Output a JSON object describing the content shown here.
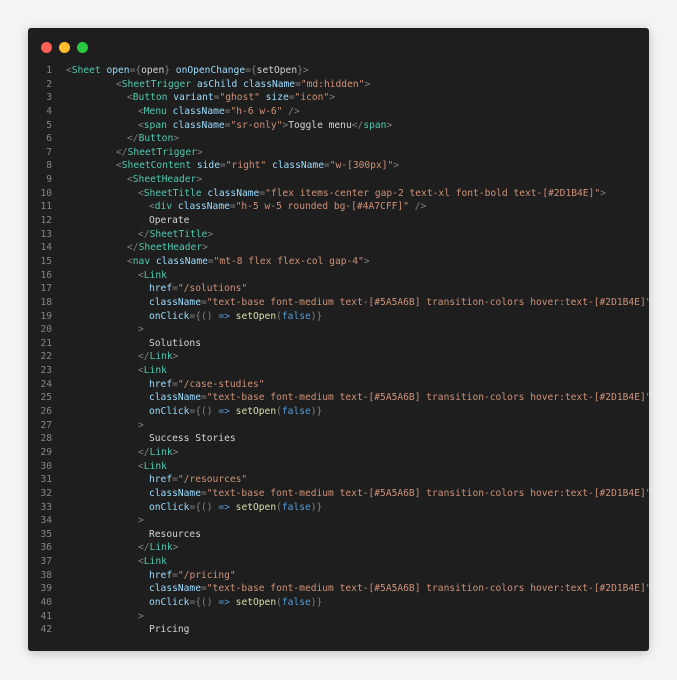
{
  "window": {
    "controls": [
      {
        "name": "close",
        "color": "#ff5f57"
      },
      {
        "name": "minimize",
        "color": "#febc2e"
      },
      {
        "name": "maximize",
        "color": "#28c840"
      }
    ]
  },
  "colors": {
    "background": "#1e1e1e",
    "line_number": "#858585",
    "tag": "#4ec9b0",
    "attr": "#9cdcfe",
    "string": "#ce9178",
    "text": "#d4d4d4",
    "keyword": "#569cd6"
  },
  "code_lines": [
    {
      "n": "1",
      "indent": 0,
      "tokens": [
        [
          "p",
          "<"
        ],
        [
          "t",
          "Sheet"
        ],
        [
          "x",
          " "
        ],
        [
          "a",
          "open"
        ],
        [
          "p",
          "={"
        ],
        [
          "x",
          "open"
        ],
        [
          "p",
          "} "
        ],
        [
          "a",
          "onOpenChange"
        ],
        [
          "p",
          "={"
        ],
        [
          "x",
          "setOpen"
        ],
        [
          "p",
          "}>"
        ]
      ]
    },
    {
      "n": "2",
      "indent": 1,
      "tokens": [
        [
          "p",
          "<"
        ],
        [
          "t",
          "SheetTrigger"
        ],
        [
          "x",
          " "
        ],
        [
          "a",
          "asChild"
        ],
        [
          "x",
          " "
        ],
        [
          "a",
          "className"
        ],
        [
          "p",
          "="
        ],
        [
          "s",
          "\"md:hidden\""
        ],
        [
          "p",
          ">"
        ]
      ]
    },
    {
      "n": "3",
      "indent": 2,
      "tokens": [
        [
          "p",
          "<"
        ],
        [
          "t",
          "Button"
        ],
        [
          "x",
          " "
        ],
        [
          "a",
          "variant"
        ],
        [
          "p",
          "="
        ],
        [
          "s",
          "\"ghost\""
        ],
        [
          "x",
          " "
        ],
        [
          "a",
          "size"
        ],
        [
          "p",
          "="
        ],
        [
          "s",
          "\"icon\""
        ],
        [
          "p",
          ">"
        ]
      ]
    },
    {
      "n": "4",
      "indent": 3,
      "tokens": [
        [
          "p",
          "<"
        ],
        [
          "t",
          "Menu"
        ],
        [
          "x",
          " "
        ],
        [
          "a",
          "className"
        ],
        [
          "p",
          "="
        ],
        [
          "s",
          "\"h-6 w-6\""
        ],
        [
          "x",
          " "
        ],
        [
          "p",
          "/>"
        ]
      ]
    },
    {
      "n": "5",
      "indent": 3,
      "tokens": [
        [
          "p",
          "<"
        ],
        [
          "t",
          "span"
        ],
        [
          "x",
          " "
        ],
        [
          "a",
          "className"
        ],
        [
          "p",
          "="
        ],
        [
          "s",
          "\"sr-only\""
        ],
        [
          "p",
          ">"
        ],
        [
          "x",
          "Toggle menu"
        ],
        [
          "p",
          "</"
        ],
        [
          "t",
          "span"
        ],
        [
          "p",
          ">"
        ]
      ]
    },
    {
      "n": "6",
      "indent": 2,
      "tokens": [
        [
          "p",
          "</"
        ],
        [
          "t",
          "Button"
        ],
        [
          "p",
          ">"
        ]
      ]
    },
    {
      "n": "7",
      "indent": 1,
      "tokens": [
        [
          "p",
          "</"
        ],
        [
          "t",
          "SheetTrigger"
        ],
        [
          "p",
          ">"
        ]
      ]
    },
    {
      "n": "8",
      "indent": 1,
      "tokens": [
        [
          "p",
          "<"
        ],
        [
          "t",
          "SheetContent"
        ],
        [
          "x",
          " "
        ],
        [
          "a",
          "side"
        ],
        [
          "p",
          "="
        ],
        [
          "s",
          "\"right\""
        ],
        [
          "x",
          " "
        ],
        [
          "a",
          "className"
        ],
        [
          "p",
          "="
        ],
        [
          "s",
          "\"w-[300px]\""
        ],
        [
          "p",
          ">"
        ]
      ]
    },
    {
      "n": "9",
      "indent": 2,
      "tokens": [
        [
          "p",
          "<"
        ],
        [
          "t",
          "SheetHeader"
        ],
        [
          "p",
          ">"
        ]
      ]
    },
    {
      "n": "10",
      "indent": 3,
      "tokens": [
        [
          "p",
          "<"
        ],
        [
          "t",
          "SheetTitle"
        ],
        [
          "x",
          " "
        ],
        [
          "a",
          "className"
        ],
        [
          "p",
          "="
        ],
        [
          "s",
          "\"flex items-center gap-2 text-xl font-bold text-[#2D1B4E]\""
        ],
        [
          "p",
          ">"
        ]
      ]
    },
    {
      "n": "11",
      "indent": 4,
      "tokens": [
        [
          "p",
          "<"
        ],
        [
          "t",
          "div"
        ],
        [
          "x",
          " "
        ],
        [
          "a",
          "className"
        ],
        [
          "p",
          "="
        ],
        [
          "s",
          "\"h-5 w-5 rounded bg-[#4A7CFF]\""
        ],
        [
          "x",
          " "
        ],
        [
          "p",
          "/>"
        ]
      ]
    },
    {
      "n": "12",
      "indent": 4,
      "tokens": [
        [
          "x",
          "Operate"
        ]
      ]
    },
    {
      "n": "13",
      "indent": 3,
      "tokens": [
        [
          "p",
          "</"
        ],
        [
          "t",
          "SheetTitle"
        ],
        [
          "p",
          ">"
        ]
      ]
    },
    {
      "n": "14",
      "indent": 2,
      "tokens": [
        [
          "p",
          "</"
        ],
        [
          "t",
          "SheetHeader"
        ],
        [
          "p",
          ">"
        ]
      ]
    },
    {
      "n": "15",
      "indent": 2,
      "tokens": [
        [
          "p",
          "<"
        ],
        [
          "t",
          "nav"
        ],
        [
          "x",
          " "
        ],
        [
          "a",
          "className"
        ],
        [
          "p",
          "="
        ],
        [
          "s",
          "\"mt-8 flex flex-col gap-4\""
        ],
        [
          "p",
          ">"
        ]
      ]
    },
    {
      "n": "16",
      "indent": 3,
      "tokens": [
        [
          "p",
          "<"
        ],
        [
          "t",
          "Link"
        ]
      ]
    },
    {
      "n": "17",
      "indent": 4,
      "tokens": [
        [
          "a",
          "href"
        ],
        [
          "p",
          "="
        ],
        [
          "s",
          "\"/solutions\""
        ]
      ]
    },
    {
      "n": "18",
      "indent": 4,
      "tokens": [
        [
          "a",
          "className"
        ],
        [
          "p",
          "="
        ],
        [
          "s",
          "\"text-base font-medium text-[#5A5A6B] transition-colors hover:text-[#2D1B4E]\""
        ]
      ]
    },
    {
      "n": "19",
      "indent": 4,
      "tokens": [
        [
          "a",
          "onClick"
        ],
        [
          "p",
          "={"
        ],
        [
          "p",
          "() "
        ],
        [
          "k",
          "=>"
        ],
        [
          "x",
          " "
        ],
        [
          "f",
          "setOpen"
        ],
        [
          "p",
          "("
        ],
        [
          "k",
          "false"
        ],
        [
          "p",
          ")}"
        ]
      ]
    },
    {
      "n": "20",
      "indent": 3,
      "tokens": [
        [
          "p",
          ">"
        ]
      ]
    },
    {
      "n": "21",
      "indent": 4,
      "tokens": [
        [
          "x",
          "Solutions"
        ]
      ]
    },
    {
      "n": "22",
      "indent": 3,
      "tokens": [
        [
          "p",
          "</"
        ],
        [
          "t",
          "Link"
        ],
        [
          "p",
          ">"
        ]
      ]
    },
    {
      "n": "23",
      "indent": 3,
      "tokens": [
        [
          "p",
          "<"
        ],
        [
          "t",
          "Link"
        ]
      ]
    },
    {
      "n": "24",
      "indent": 4,
      "tokens": [
        [
          "a",
          "href"
        ],
        [
          "p",
          "="
        ],
        [
          "s",
          "\"/case-studies\""
        ]
      ]
    },
    {
      "n": "25",
      "indent": 4,
      "tokens": [
        [
          "a",
          "className"
        ],
        [
          "p",
          "="
        ],
        [
          "s",
          "\"text-base font-medium text-[#5A5A6B] transition-colors hover:text-[#2D1B4E]\""
        ]
      ]
    },
    {
      "n": "26",
      "indent": 4,
      "tokens": [
        [
          "a",
          "onClick"
        ],
        [
          "p",
          "={"
        ],
        [
          "p",
          "() "
        ],
        [
          "k",
          "=>"
        ],
        [
          "x",
          " "
        ],
        [
          "f",
          "setOpen"
        ],
        [
          "p",
          "("
        ],
        [
          "k",
          "false"
        ],
        [
          "p",
          ")}"
        ]
      ]
    },
    {
      "n": "27",
      "indent": 3,
      "tokens": [
        [
          "p",
          ">"
        ]
      ]
    },
    {
      "n": "28",
      "indent": 4,
      "tokens": [
        [
          "x",
          "Success Stories"
        ]
      ]
    },
    {
      "n": "29",
      "indent": 3,
      "tokens": [
        [
          "p",
          "</"
        ],
        [
          "t",
          "Link"
        ],
        [
          "p",
          ">"
        ]
      ]
    },
    {
      "n": "30",
      "indent": 3,
      "tokens": [
        [
          "p",
          "<"
        ],
        [
          "t",
          "Link"
        ]
      ]
    },
    {
      "n": "31",
      "indent": 4,
      "tokens": [
        [
          "a",
          "href"
        ],
        [
          "p",
          "="
        ],
        [
          "s",
          "\"/resources\""
        ]
      ]
    },
    {
      "n": "32",
      "indent": 4,
      "tokens": [
        [
          "a",
          "className"
        ],
        [
          "p",
          "="
        ],
        [
          "s",
          "\"text-base font-medium text-[#5A5A6B] transition-colors hover:text-[#2D1B4E]\""
        ]
      ]
    },
    {
      "n": "33",
      "indent": 4,
      "tokens": [
        [
          "a",
          "onClick"
        ],
        [
          "p",
          "={"
        ],
        [
          "p",
          "() "
        ],
        [
          "k",
          "=>"
        ],
        [
          "x",
          " "
        ],
        [
          "f",
          "setOpen"
        ],
        [
          "p",
          "("
        ],
        [
          "k",
          "false"
        ],
        [
          "p",
          ")}"
        ]
      ]
    },
    {
      "n": "34",
      "indent": 3,
      "tokens": [
        [
          "p",
          ">"
        ]
      ]
    },
    {
      "n": "35",
      "indent": 4,
      "tokens": [
        [
          "x",
          "Resources"
        ]
      ]
    },
    {
      "n": "36",
      "indent": 3,
      "tokens": [
        [
          "p",
          "</"
        ],
        [
          "t",
          "Link"
        ],
        [
          "p",
          ">"
        ]
      ]
    },
    {
      "n": "37",
      "indent": 3,
      "tokens": [
        [
          "p",
          "<"
        ],
        [
          "t",
          "Link"
        ]
      ]
    },
    {
      "n": "38",
      "indent": 4,
      "tokens": [
        [
          "a",
          "href"
        ],
        [
          "p",
          "="
        ],
        [
          "s",
          "\"/pricing\""
        ]
      ]
    },
    {
      "n": "39",
      "indent": 4,
      "tokens": [
        [
          "a",
          "className"
        ],
        [
          "p",
          "="
        ],
        [
          "s",
          "\"text-base font-medium text-[#5A5A6B] transition-colors hover:text-[#2D1B4E]\""
        ]
      ]
    },
    {
      "n": "40",
      "indent": 4,
      "tokens": [
        [
          "a",
          "onClick"
        ],
        [
          "p",
          "={"
        ],
        [
          "p",
          "() "
        ],
        [
          "k",
          "=>"
        ],
        [
          "x",
          " "
        ],
        [
          "f",
          "setOpen"
        ],
        [
          "p",
          "("
        ],
        [
          "k",
          "false"
        ],
        [
          "p",
          ")}"
        ]
      ]
    },
    {
      "n": "41",
      "indent": 3,
      "tokens": [
        [
          "p",
          ">"
        ]
      ]
    },
    {
      "n": "42",
      "indent": 4,
      "tokens": [
        [
          "x",
          "Pricing"
        ]
      ]
    }
  ]
}
